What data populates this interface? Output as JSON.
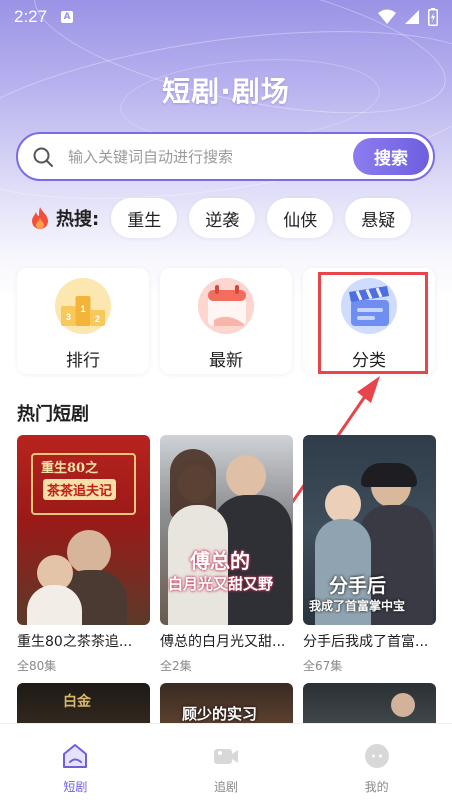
{
  "status_bar": {
    "time": "2:27",
    "a_icon": "A"
  },
  "header": {
    "title": "短剧·剧场"
  },
  "search": {
    "placeholder": "输入关键词自动进行搜索",
    "button_label": "搜索"
  },
  "hot_search": {
    "label": "热搜:",
    "chips": [
      "重生",
      "逆袭",
      "仙侠",
      "悬疑"
    ]
  },
  "categories": [
    {
      "label": "排行",
      "icon": "ranking-podium-icon"
    },
    {
      "label": "最新",
      "icon": "calendar-icon"
    },
    {
      "label": "分类",
      "icon": "clapperboard-icon"
    }
  ],
  "hot_dramas": {
    "title": "热门短剧",
    "items": [
      {
        "name": "重生80之茶茶追...",
        "episodes": "全80集",
        "poster_text": "重生80之",
        "poster_sub": "茶茶追夫记"
      },
      {
        "name": "傅总的白月光又甜...",
        "episodes": "全2集",
        "poster_text": "傅总的",
        "poster_sub": "白月光又甜又野"
      },
      {
        "name": "分手后我成了首富...",
        "episodes": "全67集",
        "poster_text": "分手后",
        "poster_sub": "我成了首富掌中宝"
      }
    ],
    "row2_text": [
      "白金",
      "顾少的实习",
      ""
    ]
  },
  "bottom_nav": [
    {
      "label": "短剧",
      "icon": "home-drama-icon",
      "active": true
    },
    {
      "label": "追剧",
      "icon": "video-camera-icon",
      "active": false
    },
    {
      "label": "我的",
      "icon": "profile-icon",
      "active": false
    }
  ],
  "colors": {
    "accent": "#6e5fe0",
    "highlight": "#e8454b"
  }
}
